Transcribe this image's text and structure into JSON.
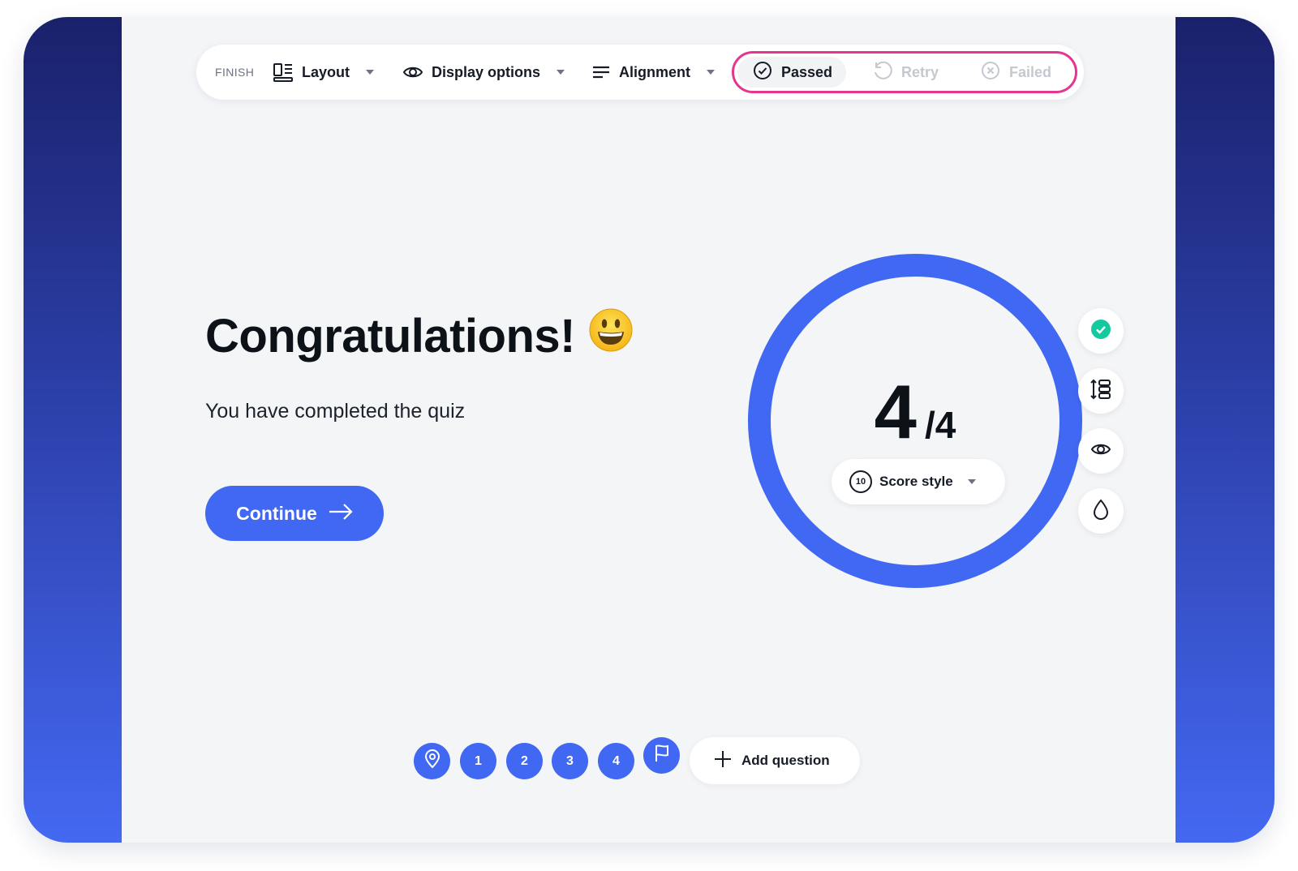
{
  "toolbar": {
    "section_label": "FINISH",
    "layout_label": "Layout",
    "display_options_label": "Display options",
    "alignment_label": "Alignment",
    "status": {
      "passed": "Passed",
      "retry": "Retry",
      "failed": "Failed",
      "selected": "passed"
    }
  },
  "result": {
    "headline": "Congratulations!",
    "emoji": "😃",
    "subtitle": "You have completed the quiz",
    "continue_label": "Continue"
  },
  "score": {
    "value": "4",
    "total": "/4",
    "style_badge": "10",
    "style_label": "Score style"
  },
  "side_tools": [
    "check-circle-icon",
    "spacing-icon",
    "eye-icon",
    "droplet-icon"
  ],
  "bottom_nav": {
    "questions": [
      "1",
      "2",
      "3",
      "4"
    ],
    "add_question_label": "Add question"
  },
  "colors": {
    "accent": "#4168f2",
    "highlight_border": "#e6358f",
    "success": "#14c9a0",
    "frame_top": "#1a216b",
    "frame_bottom": "#4468f2"
  }
}
